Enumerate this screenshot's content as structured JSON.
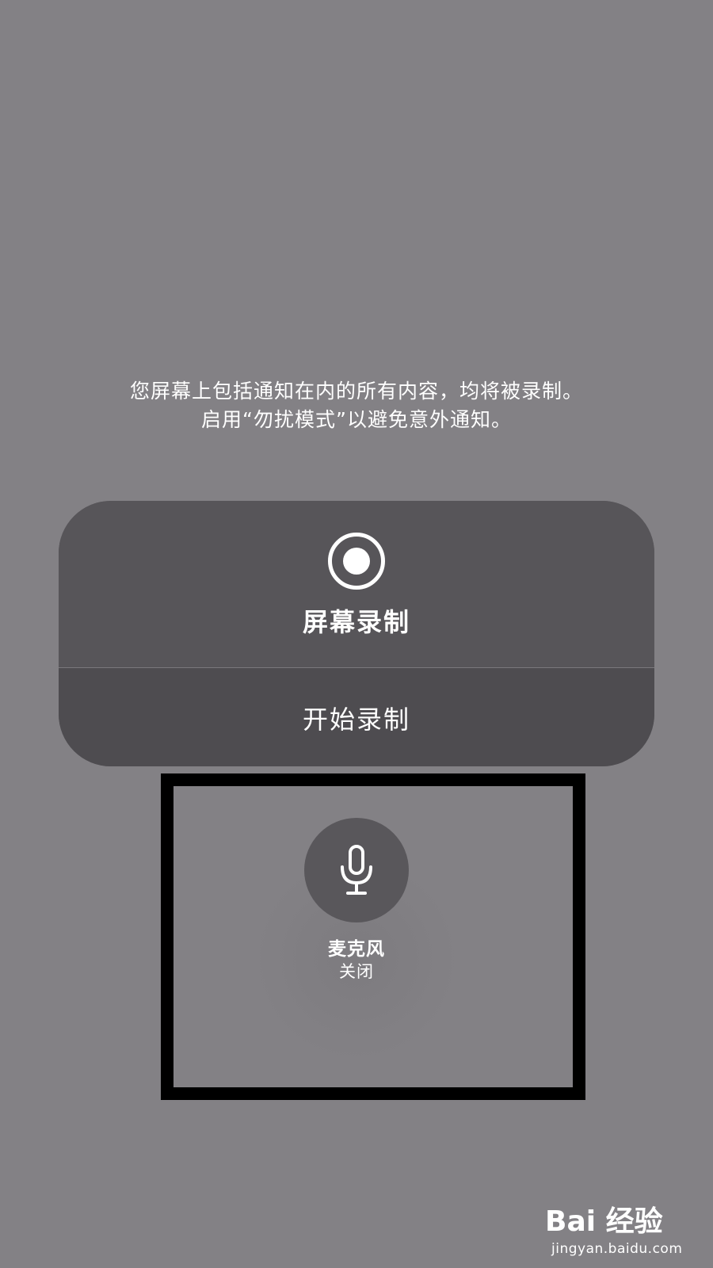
{
  "notice": {
    "line1": "您屏幕上包括通知在内的所有内容，均将被录制。",
    "line2": "启用“勿扰模式”以避免意外通知。"
  },
  "record_card": {
    "icon": "record-icon",
    "title": "屏幕录制",
    "start_label": "开始录制"
  },
  "microphone": {
    "icon": "microphone-icon",
    "label": "麦克风",
    "status": "关闭"
  },
  "watermark": {
    "brand": "Bai 经验",
    "url": "jingyan.baidu.com"
  },
  "colors": {
    "background": "#838185",
    "card": "#575559",
    "button": "#4e4c50",
    "highlight_border": "#000000",
    "text": "#ffffff"
  }
}
